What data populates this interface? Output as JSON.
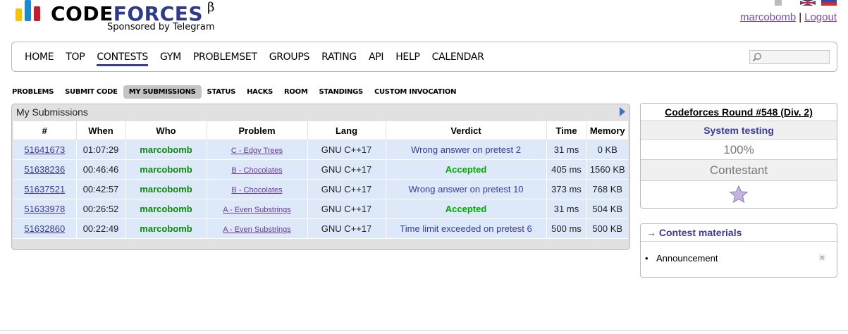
{
  "header": {
    "logo_code": "CODE",
    "logo_forces": "FORCES",
    "logo_beta": "β",
    "sponsor": "Sponsored by Telegram",
    "user": "marcobomb",
    "separator": "|",
    "logout": "Logout"
  },
  "nav": {
    "items": [
      "HOME",
      "TOP",
      "CONTESTS",
      "GYM",
      "PROBLEMSET",
      "GROUPS",
      "RATING",
      "API",
      "HELP",
      "CALENDAR"
    ],
    "active": "CONTESTS",
    "search_placeholder": ""
  },
  "second_menu": {
    "items": [
      "PROBLEMS",
      "SUBMIT CODE",
      "MY SUBMISSIONS",
      "STATUS",
      "HACKS",
      "ROOM",
      "STANDINGS",
      "CUSTOM INVOCATION"
    ],
    "selected": "MY SUBMISSIONS"
  },
  "submissions": {
    "title": "My Submissions",
    "columns": [
      "#",
      "When",
      "Who",
      "Problem",
      "Lang",
      "Verdict",
      "Time",
      "Memory"
    ],
    "rows": [
      {
        "id": "51641673",
        "when": "01:07:29",
        "who": "marcobomb",
        "problem": "C - Edgy Trees",
        "lang": "GNU C++17",
        "verdict": "Wrong answer on pretest 2",
        "accepted": false,
        "time": "31 ms",
        "memory": "0 KB"
      },
      {
        "id": "51638236",
        "when": "00:46:46",
        "who": "marcobomb",
        "problem": "B - Chocolates",
        "lang": "GNU C++17",
        "verdict": "Accepted",
        "accepted": true,
        "time": "405 ms",
        "memory": "1560 KB"
      },
      {
        "id": "51637521",
        "when": "00:42:57",
        "who": "marcobomb",
        "problem": "B - Chocolates",
        "lang": "GNU C++17",
        "verdict": "Wrong answer on pretest 10",
        "accepted": false,
        "time": "373 ms",
        "memory": "768 KB"
      },
      {
        "id": "51633978",
        "when": "00:26:52",
        "who": "marcobomb",
        "problem": "A - Even Substrings",
        "lang": "GNU C++17",
        "verdict": "Accepted",
        "accepted": true,
        "time": "31 ms",
        "memory": "504 KB"
      },
      {
        "id": "51632860",
        "when": "00:22:49",
        "who": "marcobomb",
        "problem": "A - Even Substrings",
        "lang": "GNU C++17",
        "verdict": "Time limit exceeded on pretest 6",
        "accepted": false,
        "time": "500 ms",
        "memory": "500 KB"
      }
    ]
  },
  "round": {
    "title": "Codeforces Round #548 (Div. 2)",
    "phase": "System testing",
    "percent": "100%",
    "participant_type": "Contestant",
    "icon": "star-icon"
  },
  "materials": {
    "title": "→ Contest materials",
    "items": [
      "Announcement"
    ]
  },
  "colors": {
    "accent": "#3b3b9f",
    "accepted": "#00aa00",
    "row_bg": "#dde8f8"
  }
}
